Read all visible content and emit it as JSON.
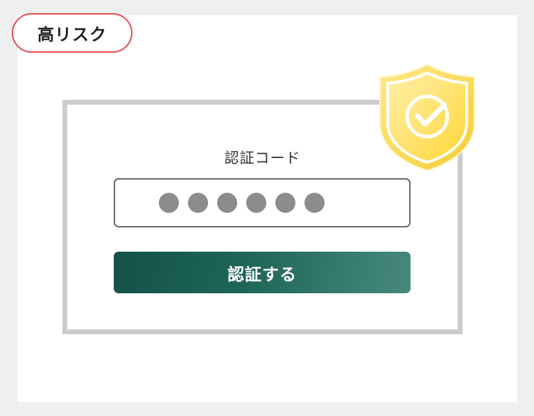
{
  "badge": {
    "label": "高リスク"
  },
  "verification": {
    "code_label": "認証コード",
    "masked_digits": 6,
    "submit_label": "認証する"
  },
  "icons": {
    "shield": "shield-check-icon"
  },
  "colors": {
    "badge_border": "#e8474f",
    "button_start": "#13524a",
    "button_end": "#478a7d",
    "shield_gold": "#ffd53d",
    "dot_gray": "#8c8c8c"
  }
}
